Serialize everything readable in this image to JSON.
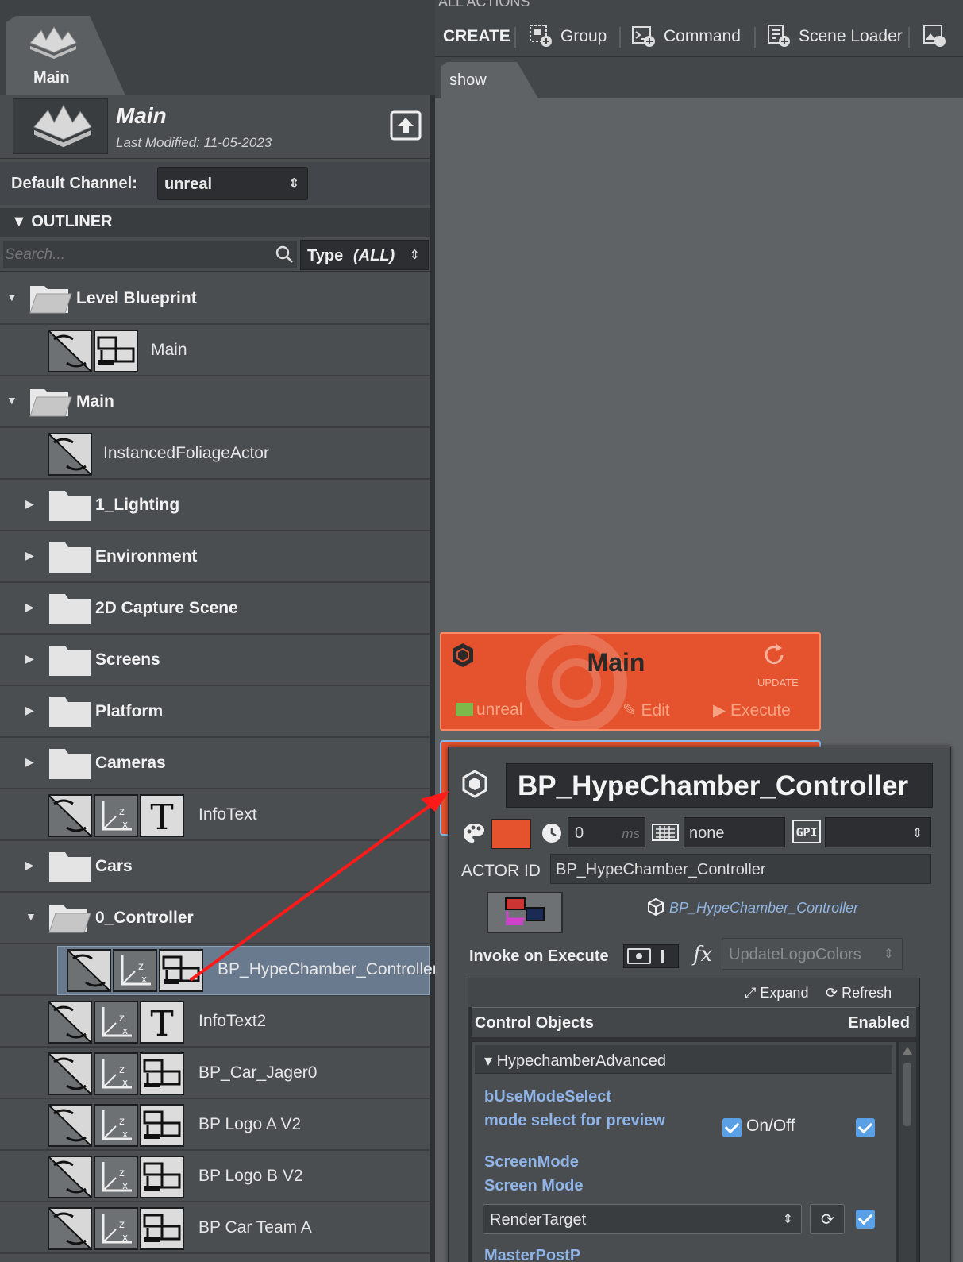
{
  "left": {
    "tab_label": "Main",
    "project_name": "Main",
    "last_modified": "Last Modified: 11-05-2023",
    "default_channel_label": "Default Channel:",
    "default_channel_value": "unreal",
    "outliner_title": "▼ OUTLINER",
    "search_placeholder": "Search...",
    "type_filter_label": "Type",
    "type_filter_value": "(ALL)",
    "tree": [
      {
        "label": "Level Blueprint",
        "kind": "folder",
        "expanded": true
      },
      {
        "label": "Main",
        "kind": "actor"
      },
      {
        "label": "Main",
        "kind": "folder",
        "expanded": true
      },
      {
        "label": "InstancedFoliageActor",
        "kind": "actor"
      },
      {
        "label": "1_Lighting",
        "kind": "folder",
        "expanded": false
      },
      {
        "label": "Environment",
        "kind": "folder",
        "expanded": false
      },
      {
        "label": "2D Capture Scene",
        "kind": "folder",
        "expanded": false
      },
      {
        "label": "Screens",
        "kind": "folder",
        "expanded": false
      },
      {
        "label": "Platform",
        "kind": "folder",
        "expanded": false
      },
      {
        "label": "Cameras",
        "kind": "folder",
        "expanded": false
      },
      {
        "label": "InfoText",
        "kind": "actor"
      },
      {
        "label": "Cars",
        "kind": "folder",
        "expanded": false
      },
      {
        "label": "0_Controller",
        "kind": "folder",
        "expanded": true
      },
      {
        "label": "BP_HypeChamber_Controller",
        "kind": "actor",
        "selected": true
      },
      {
        "label": "InfoText2",
        "kind": "actor"
      },
      {
        "label": "BP_Car_Jager0",
        "kind": "actor"
      },
      {
        "label": "BP Logo A V2",
        "kind": "actor"
      },
      {
        "label": "BP Logo B V2",
        "kind": "actor"
      },
      {
        "label": "BP Car Team A",
        "kind": "actor"
      }
    ]
  },
  "toolbar": {
    "cut_title": "ALL ACTIONS",
    "create": "CREATE",
    "group": "Group",
    "command": "Command",
    "scene_loader": "Scene Loader"
  },
  "tabs": {
    "show": "show"
  },
  "card": {
    "title": "Main",
    "update": "UPDATE",
    "channel": "unreal",
    "edit": "Edit",
    "execute": "Execute",
    "color": "#e5522e"
  },
  "popup": {
    "title": "BP_HypeChamber_Controller",
    "delay_value": "0",
    "delay_unit": "ms",
    "hotkey": "none",
    "actor_id_label": "ACTOR ID",
    "actor_id_value": "BP_HypeChamber_Controller",
    "blueprint_link": "BP_HypeChamber_Controller",
    "invoke_label": "Invoke on Execute",
    "function_value": "UpdateLogoColors",
    "expand": "Expand",
    "refresh": "Refresh",
    "control_objects": "Control Objects",
    "enabled": "Enabled",
    "group_name": "▾ HypechamberAdvanced",
    "prop1_name": "bUseModeSelect",
    "prop1_desc": "mode select for preview",
    "prop1_toggle": "On/Off",
    "prop2_name": "ScreenMode",
    "prop2_desc": "Screen Mode",
    "prop2_value": "RenderTarget",
    "prop3_cut": "MasterPostP"
  },
  "colors": {
    "accent": "#e5522e",
    "link": "#8fb4e0",
    "check": "#5aa0e6"
  }
}
